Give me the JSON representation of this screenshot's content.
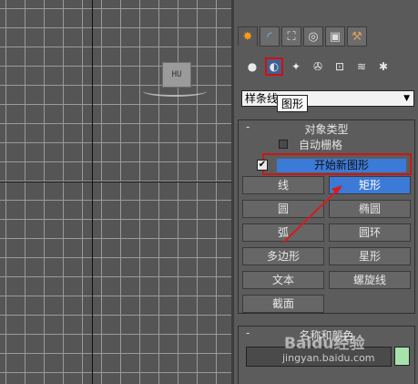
{
  "viewport": {
    "object_label": "HU"
  },
  "panel": {
    "tabs": [
      {
        "icon": "create-tab-icon",
        "glyph": "✸"
      },
      {
        "icon": "modify-tab-icon",
        "glyph": "◜"
      },
      {
        "icon": "hierarchy-tab-icon",
        "glyph": "⛶"
      },
      {
        "icon": "motion-tab-icon",
        "glyph": "◎"
      },
      {
        "icon": "display-tab-icon",
        "glyph": "▣"
      },
      {
        "icon": "utilities-tab-icon",
        "glyph": "⚒"
      }
    ],
    "category_icons": [
      {
        "icon": "geometry-icon",
        "glyph": "●"
      },
      {
        "icon": "shapes-icon",
        "glyph": "◐"
      },
      {
        "icon": "lights-icon",
        "glyph": "✦"
      },
      {
        "icon": "cameras-icon",
        "glyph": "✇"
      },
      {
        "icon": "helpers-icon",
        "glyph": "⊡"
      },
      {
        "icon": "space-warps-icon",
        "glyph": "≋"
      },
      {
        "icon": "systems-icon",
        "glyph": "✱"
      }
    ],
    "dropdown_value": "样条线",
    "tooltip": "图形",
    "object_type": {
      "collapse_glyph": "-",
      "title": "对象类型",
      "auto_grid": "自动栅格",
      "start_new_shape": "开始新图形",
      "check_glyph": "✔",
      "buttons": [
        "线",
        "矩形",
        "圆",
        "椭圆",
        "弧",
        "圆环",
        "多边形",
        "星形",
        "文本",
        "螺旋线",
        "截面"
      ],
      "active_button": "矩形"
    },
    "name_color": {
      "collapse_glyph": "-",
      "title": "名称和颜色",
      "swatch_color": "#a7e2ad"
    }
  },
  "watermark": {
    "logo": "Baidu经验",
    "url": "jingyan.baidu.com"
  }
}
